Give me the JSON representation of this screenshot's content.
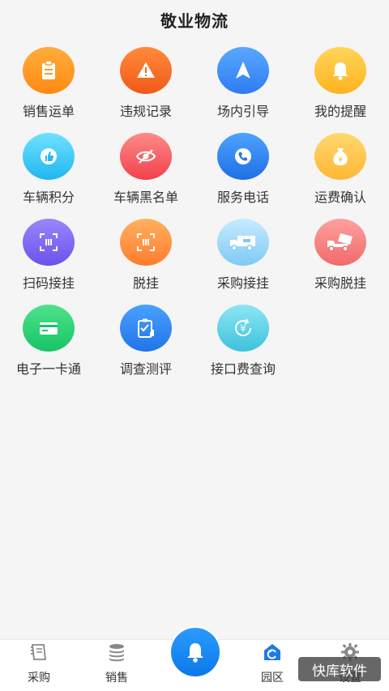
{
  "header": {
    "title": "敬业物流"
  },
  "menu": [
    {
      "label": "销售运单",
      "icon": "clipboard-icon",
      "color": "orange"
    },
    {
      "label": "违规记录",
      "icon": "warning-icon",
      "color": "red-orange"
    },
    {
      "label": "场内引导",
      "icon": "navigation-arrow-icon",
      "color": "blue"
    },
    {
      "label": "我的提醒",
      "icon": "bell-icon",
      "color": "yellow"
    },
    {
      "label": "车辆积分",
      "icon": "thumbs-up-icon",
      "color": "cyan"
    },
    {
      "label": "车辆黑名单",
      "icon": "eye-off-icon",
      "color": "red"
    },
    {
      "label": "服务电话",
      "icon": "phone-icon",
      "color": "blue"
    },
    {
      "label": "运费确认",
      "icon": "money-bag-icon",
      "color": "yellow"
    },
    {
      "label": "扫码接挂",
      "icon": "scan-icon",
      "color": "purple"
    },
    {
      "label": "脱挂",
      "icon": "scan-icon",
      "color": "orange"
    },
    {
      "label": "采购接挂",
      "icon": "truck-icon",
      "color": "light-blue"
    },
    {
      "label": "采购脱挂",
      "icon": "truck-icon",
      "color": "pink"
    },
    {
      "label": "电子一卡通",
      "icon": "card-icon",
      "color": "green"
    },
    {
      "label": "调查测评",
      "icon": "survey-icon",
      "color": "blue"
    },
    {
      "label": "接口费查询",
      "icon": "yuan-refresh-icon",
      "color": "teal"
    }
  ],
  "tabbar": {
    "purchase": "采购",
    "sales": "销售",
    "park": "园区",
    "settings": "设置"
  },
  "watermark": "快库软件"
}
